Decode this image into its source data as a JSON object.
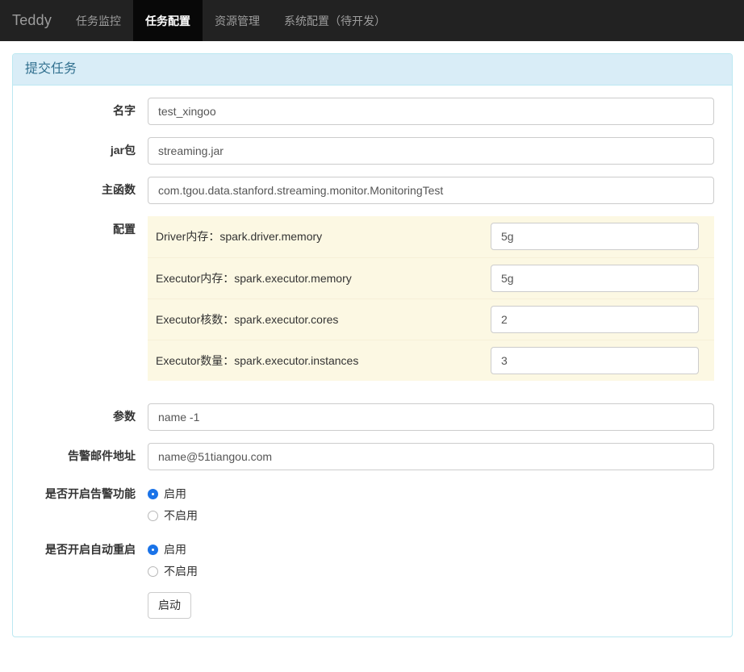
{
  "navbar": {
    "brand": "Teddy",
    "items": [
      {
        "label": "任务监控",
        "active": false
      },
      {
        "label": "任务配置",
        "active": true
      },
      {
        "label": "资源管理",
        "active": false
      },
      {
        "label": "系统配置（待开发）",
        "active": false
      }
    ]
  },
  "panel": {
    "heading": "提交任务",
    "fields": {
      "name": {
        "label": "名字",
        "value": "test_xingoo"
      },
      "jar": {
        "label": "jar包",
        "value": "streaming.jar"
      },
      "main_class": {
        "label": "主函数",
        "value": "com.tgou.data.stanford.streaming.monitor.MonitoringTest"
      },
      "config": {
        "label": "配置"
      },
      "args": {
        "label": "参数",
        "value": "name -1"
      },
      "email": {
        "label": "告警邮件地址",
        "value": "name@51tiangou.com"
      },
      "alarm": {
        "label": "是否开启告警功能"
      },
      "restart": {
        "label": "是否开启自动重启"
      }
    },
    "config_rows": [
      {
        "key": "Driver内存：spark.driver.memory",
        "value": "5g"
      },
      {
        "key": "Executor内存：spark.executor.memory",
        "value": "5g"
      },
      {
        "key": "Executor核数：spark.executor.cores",
        "value": "2"
      },
      {
        "key": "Executor数量：spark.executor.instances",
        "value": "3"
      }
    ],
    "alarm_options": [
      {
        "label": "启用",
        "checked": true
      },
      {
        "label": "不启用",
        "checked": false
      }
    ],
    "restart_options": [
      {
        "label": "启用",
        "checked": true
      },
      {
        "label": "不启用",
        "checked": false
      }
    ],
    "submit_label": "启动"
  },
  "colors": {
    "navbar_bg": "#222222",
    "navbar_active_bg": "#080808",
    "panel_border": "#bce8f1",
    "panel_heading_bg": "#d9edf7",
    "panel_heading_text": "#31708f",
    "config_bg": "#fcf8e3",
    "radio_accent": "#1a73e8"
  }
}
